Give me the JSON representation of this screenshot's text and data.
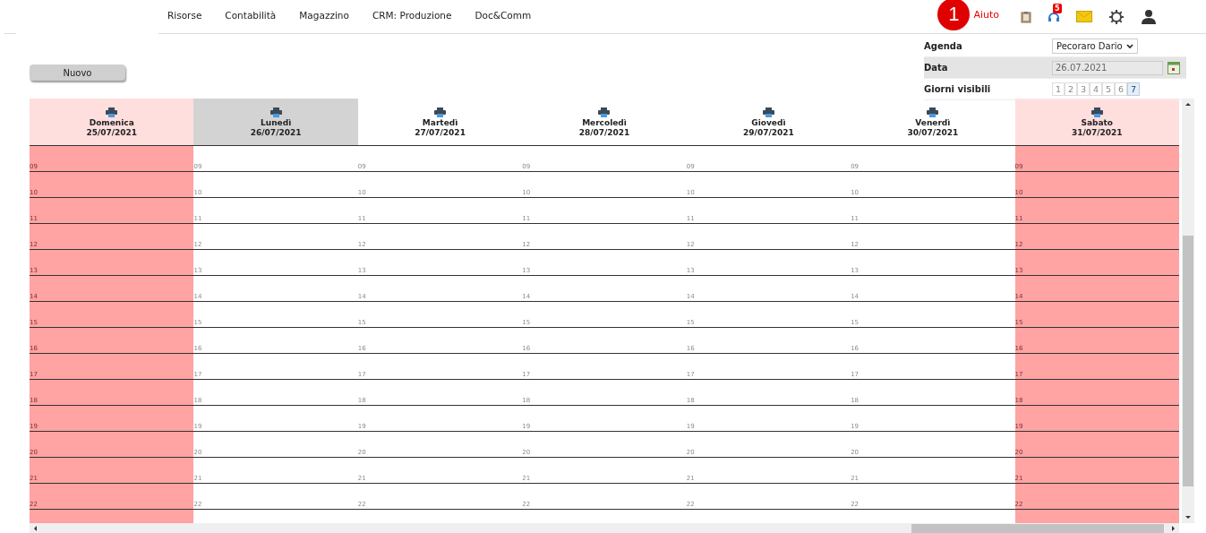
{
  "nav": {
    "items": [
      "Risorse",
      "Contabilità",
      "Magazzino",
      "CRM: Produzione",
      "Doc&Comm"
    ]
  },
  "header": {
    "marker": "1",
    "help": "Aiuto",
    "notifications_badge": "5"
  },
  "new_button": "Nuovo",
  "filters": {
    "agenda_label": "Agenda",
    "agenda_value": "Pecoraro Dario",
    "date_label": "Data",
    "date_value": "26.07.2021",
    "days_label": "Giorni visibili",
    "day_counts": [
      {
        "label": "1",
        "selected": false
      },
      {
        "label": "2",
        "selected": false
      },
      {
        "label": "3",
        "selected": false
      },
      {
        "label": "4",
        "selected": false
      },
      {
        "label": "5",
        "selected": false
      },
      {
        "label": "6",
        "selected": false
      },
      {
        "label": "7",
        "selected": true
      }
    ]
  },
  "days": [
    {
      "name": "Domenica",
      "date": "25/07/2021",
      "weekend": true,
      "selected": false,
      "hours": [
        "09",
        "10",
        "11",
        "12",
        "13",
        "14",
        "15",
        "16",
        "17",
        "18",
        "19",
        "20",
        "21",
        "22"
      ]
    },
    {
      "name": "Lunedì",
      "date": "26/07/2021",
      "weekend": false,
      "selected": true,
      "hours": [
        "09",
        "10",
        "11",
        "12",
        "13",
        "14",
        "15",
        "16",
        "17",
        "18",
        "19",
        "20",
        "21",
        "22"
      ]
    },
    {
      "name": "Martedì",
      "date": "27/07/2021",
      "weekend": false,
      "selected": false,
      "hours": [
        "09",
        "10",
        "11",
        "12",
        "13",
        "14",
        "15",
        "16",
        "17",
        "18",
        "19",
        "20",
        "21",
        "22"
      ]
    },
    {
      "name": "Mercoledì",
      "date": "28/07/2021",
      "weekend": false,
      "selected": false,
      "hours": [
        "09",
        "10",
        "11",
        "12",
        "13",
        "14",
        "15",
        "16",
        "17",
        "18",
        "19",
        "20",
        "21",
        "22"
      ]
    },
    {
      "name": "Giovedì",
      "date": "29/07/2021",
      "weekend": false,
      "selected": false,
      "hours": [
        "09",
        "10",
        "11",
        "12",
        "13",
        "14",
        "15",
        "16",
        "17",
        "18",
        "19",
        "20",
        "21",
        "22"
      ]
    },
    {
      "name": "Venerdì",
      "date": "30/07/2021",
      "weekend": false,
      "selected": false,
      "hours": [
        "09",
        "10",
        "11",
        "12",
        "13",
        "14",
        "15",
        "16",
        "17",
        "18",
        "19",
        "20",
        "21",
        "22"
      ]
    },
    {
      "name": "Sabato",
      "date": "31/07/2021",
      "weekend": true,
      "selected": false,
      "hours": [
        "09",
        "10",
        "11",
        "12",
        "13",
        "14",
        "15",
        "16",
        "17",
        "18",
        "19",
        "20",
        "21",
        "22"
      ]
    }
  ]
}
